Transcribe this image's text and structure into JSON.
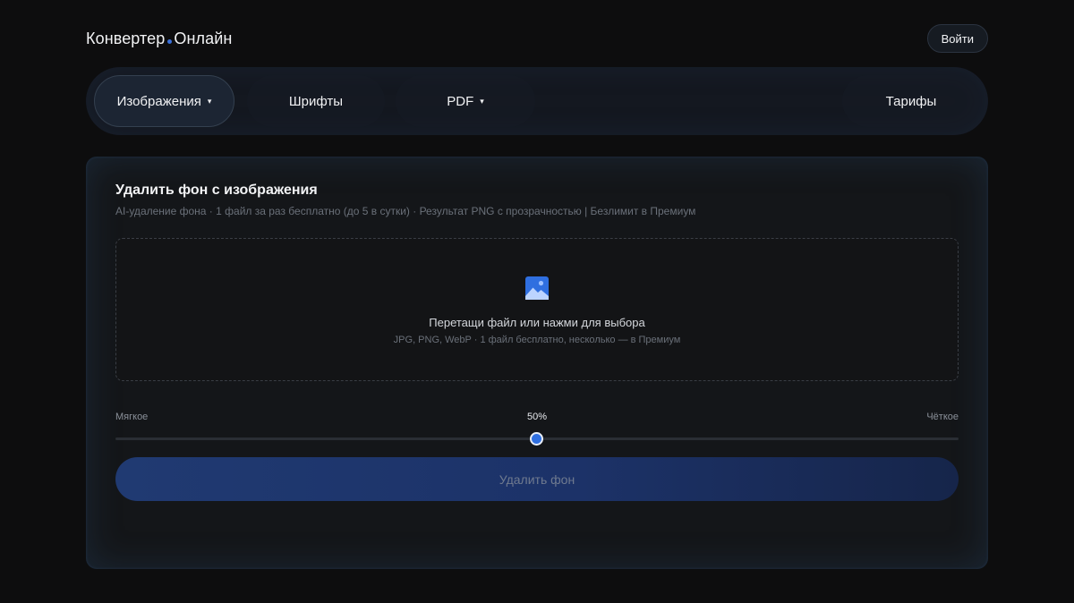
{
  "header": {
    "logo_left": "Конвертер",
    "logo_right": "Онлайн",
    "login_label": "Войти"
  },
  "nav": {
    "items": [
      {
        "label": "Изображения",
        "dropdown": true,
        "active": true
      },
      {
        "label": "Шрифты",
        "dropdown": false,
        "active": false
      },
      {
        "label": "PDF",
        "dropdown": true,
        "active": false
      },
      {
        "label": "Тарифы",
        "dropdown": false,
        "active": false
      }
    ],
    "caret": "▾"
  },
  "card": {
    "title": "Удалить фон с изображения",
    "subtitle": "AI-удаление фона · 1 файл за раз бесплатно (до 5 в сутки) · Результат PNG с прозрачностью | Безлимит в Премиум",
    "dropzone": {
      "icon": "image-icon",
      "text": "Перетащи файл или нажми для выбора",
      "hint": "JPG, PNG, WebP · 1 файл бесплатно, несколько — в Премиум"
    },
    "slider": {
      "min_label": "Мягкое",
      "max_label": "Чёткое",
      "value_label": "50%",
      "value": 0.5
    },
    "action_label": "Удалить фон"
  },
  "colors": {
    "accent": "#2f6fe0",
    "background": "#0d0d0e",
    "card": "#141619"
  }
}
